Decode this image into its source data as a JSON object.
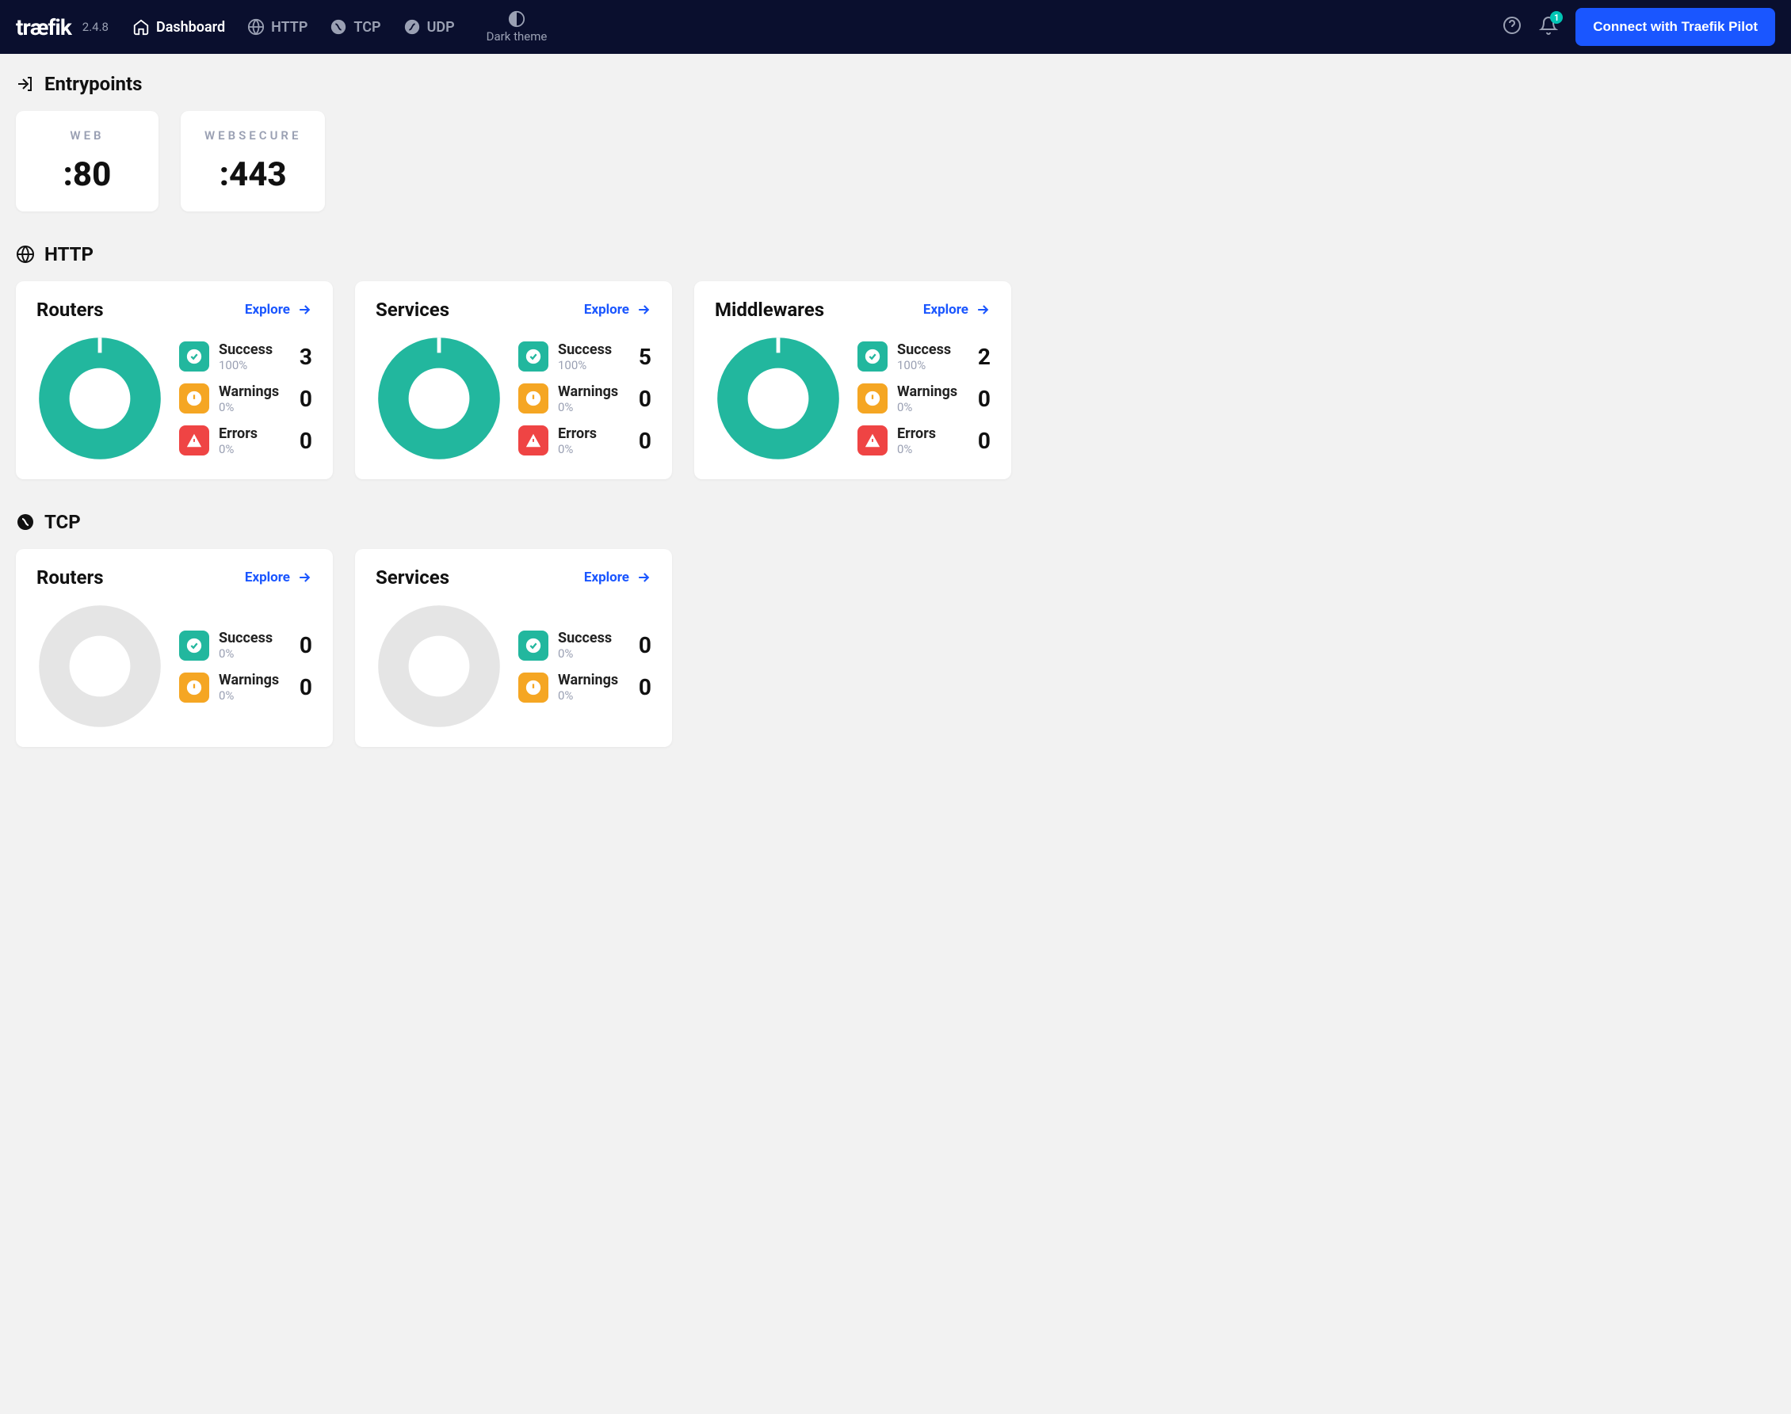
{
  "app": {
    "name": "træfik",
    "version": "2.4.8"
  },
  "nav": {
    "dashboard": "Dashboard",
    "http": "HTTP",
    "tcp": "TCP",
    "udp": "UDP",
    "theme": "Dark theme"
  },
  "header": {
    "pilot_button": "Connect with Traefik Pilot",
    "notification_count": "1"
  },
  "sections": {
    "entrypoints_title": "Entrypoints",
    "http_title": "HTTP",
    "tcp_title": "TCP"
  },
  "entrypoints": [
    {
      "name": "WEB",
      "port": ":80"
    },
    {
      "name": "WEBSECURE",
      "port": ":443"
    }
  ],
  "labels": {
    "explore": "Explore",
    "success": "Success",
    "warnings": "Warnings",
    "errors": "Errors"
  },
  "http_cards": [
    {
      "title": "Routers",
      "success_pct": "100%",
      "success_n": "3",
      "warn_pct": "0%",
      "warn_n": "0",
      "err_pct": "0%",
      "err_n": "0",
      "donut_full": true
    },
    {
      "title": "Services",
      "success_pct": "100%",
      "success_n": "5",
      "warn_pct": "0%",
      "warn_n": "0",
      "err_pct": "0%",
      "err_n": "0",
      "donut_full": true
    },
    {
      "title": "Middlewares",
      "success_pct": "100%",
      "success_n": "2",
      "warn_pct": "0%",
      "warn_n": "0",
      "err_pct": "0%",
      "err_n": "0",
      "donut_full": true
    }
  ],
  "tcp_cards": [
    {
      "title": "Routers",
      "success_pct": "0%",
      "success_n": "0",
      "warn_pct": "0%",
      "warn_n": "0",
      "donut_full": false
    },
    {
      "title": "Services",
      "success_pct": "0%",
      "success_n": "0",
      "warn_pct": "0%",
      "warn_n": "0",
      "donut_full": false
    }
  ],
  "colors": {
    "success": "#22b79e",
    "warning": "#f5a623",
    "error": "#ef4444",
    "empty": "#e5e5e5",
    "accent": "#1a56ff"
  },
  "chart_data": [
    {
      "type": "pie",
      "title": "HTTP Routers",
      "categories": [
        "Success",
        "Warnings",
        "Errors"
      ],
      "values": [
        3,
        0,
        0
      ]
    },
    {
      "type": "pie",
      "title": "HTTP Services",
      "categories": [
        "Success",
        "Warnings",
        "Errors"
      ],
      "values": [
        5,
        0,
        0
      ]
    },
    {
      "type": "pie",
      "title": "HTTP Middlewares",
      "categories": [
        "Success",
        "Warnings",
        "Errors"
      ],
      "values": [
        2,
        0,
        0
      ]
    },
    {
      "type": "pie",
      "title": "TCP Routers",
      "categories": [
        "Success",
        "Warnings",
        "Errors"
      ],
      "values": [
        0,
        0,
        0
      ]
    },
    {
      "type": "pie",
      "title": "TCP Services",
      "categories": [
        "Success",
        "Warnings",
        "Errors"
      ],
      "values": [
        0,
        0,
        0
      ]
    }
  ]
}
